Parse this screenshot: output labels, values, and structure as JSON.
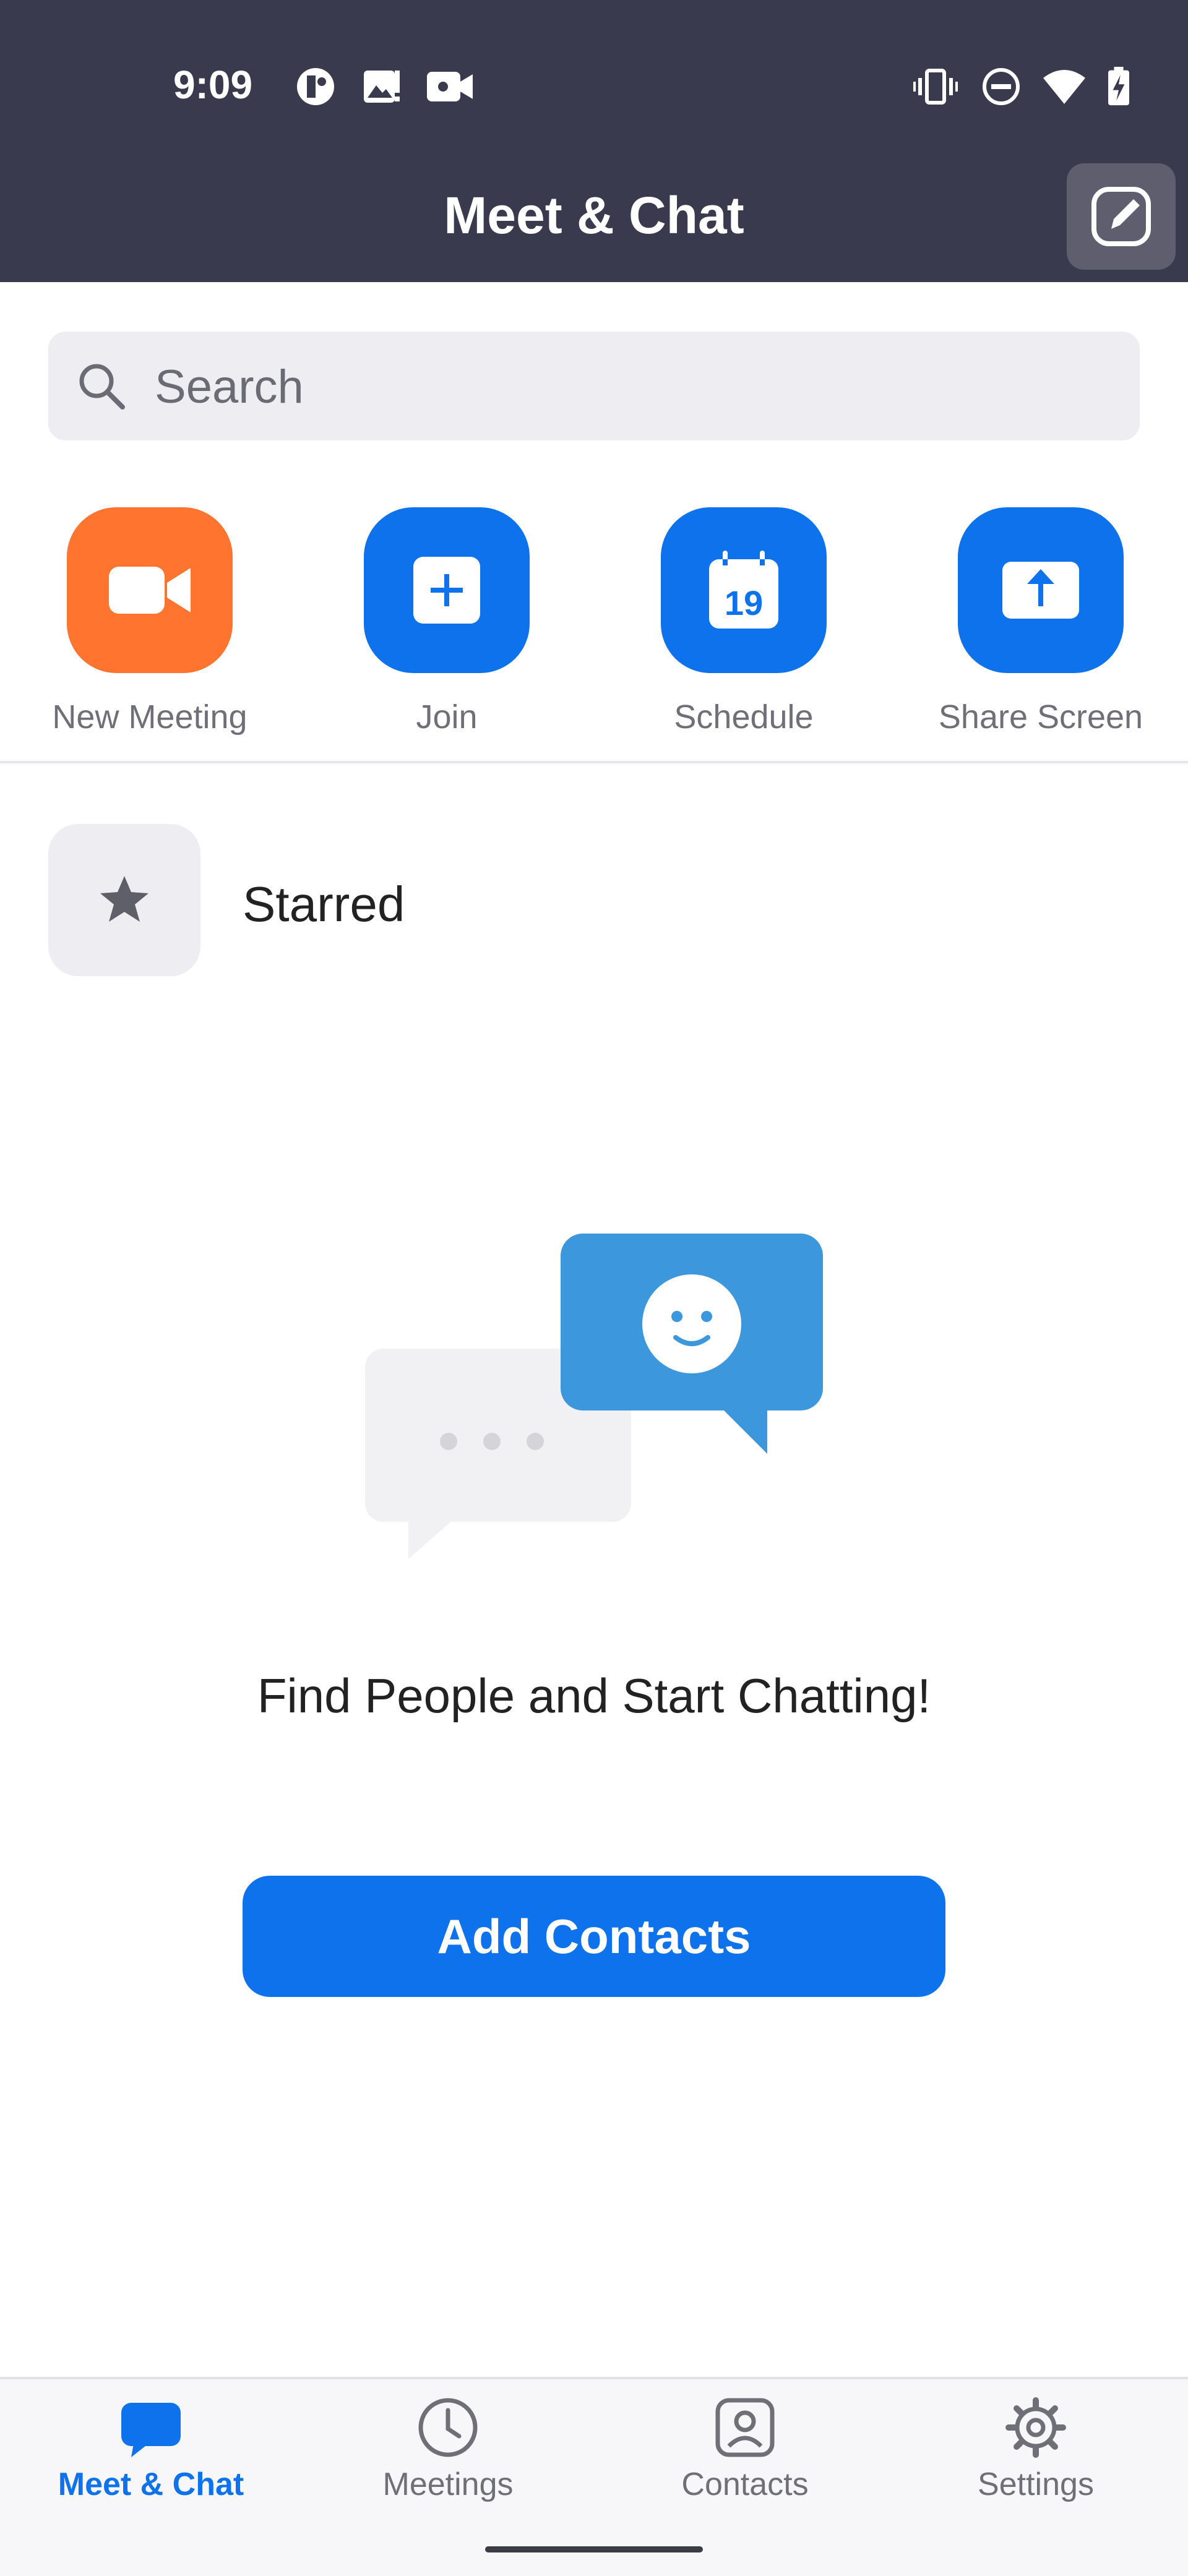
{
  "status_bar": {
    "time": "9:09"
  },
  "header": {
    "title": "Meet & Chat"
  },
  "search": {
    "placeholder": "Search"
  },
  "actions": [
    {
      "label": "New Meeting",
      "icon": "video-camera-icon",
      "color": "#ff742e"
    },
    {
      "label": "Join",
      "icon": "plus-icon",
      "color": "#0e72ed"
    },
    {
      "label": "Schedule",
      "icon": "calendar-icon",
      "color": "#0e72ed",
      "calendar_day": "19"
    },
    {
      "label": "Share Screen",
      "icon": "share-up-arrow-icon",
      "color": "#0e72ed"
    }
  ],
  "starred": {
    "label": "Starred"
  },
  "empty_state": {
    "message": "Find People and Start Chatting!"
  },
  "add_contacts": {
    "label": "Add Contacts"
  },
  "bottom_nav": [
    {
      "label": "Meet & Chat",
      "icon": "chat-bubble-icon",
      "active": true
    },
    {
      "label": "Meetings",
      "icon": "clock-icon",
      "active": false
    },
    {
      "label": "Contacts",
      "icon": "contact-card-icon",
      "active": false
    },
    {
      "label": "Settings",
      "icon": "gear-icon",
      "active": false
    }
  ],
  "colors": {
    "accent": "#0e72ed",
    "orange": "#ff742e",
    "header_bg": "#3a3a4e"
  }
}
